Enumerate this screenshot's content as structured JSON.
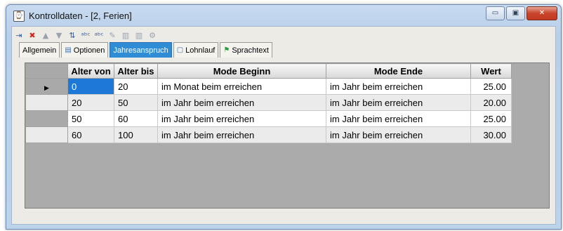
{
  "window": {
    "title": "Kontrolldaten - [2, Ferien]",
    "icon": "app-window-icon",
    "controls": {
      "minimize": "▭",
      "maximize": "▣",
      "close": "✕"
    }
  },
  "toolbar": {
    "icons": [
      {
        "name": "insert-row-icon",
        "glyph": "⇥"
      },
      {
        "name": "delete-row-icon",
        "glyph": "✖"
      },
      {
        "name": "move-up-icon",
        "glyph": "▲"
      },
      {
        "name": "move-down-icon",
        "glyph": "▼"
      },
      {
        "name": "sort-az-icon",
        "glyph": "⇅"
      },
      {
        "name": "spellcheck-icon",
        "glyph": "ᵃᵇᶜ"
      },
      {
        "name": "spellcheck-all-icon",
        "glyph": "ᵃᵇᶜ"
      },
      {
        "name": "edit-icon",
        "glyph": "✎"
      },
      {
        "name": "columns-icon",
        "glyph": "▥"
      },
      {
        "name": "columns-settings-icon",
        "glyph": "▥"
      },
      {
        "name": "properties-icon",
        "glyph": "⚙"
      }
    ]
  },
  "tabs": [
    {
      "label": "Allgemein",
      "icon": ""
    },
    {
      "label": "Optionen",
      "icon": "▤"
    },
    {
      "label": "Jahresanspruch",
      "icon": ""
    },
    {
      "label": "Lohnlauf",
      "icon": "▢"
    },
    {
      "label": "Sprachtext",
      "icon": "⚑"
    }
  ],
  "active_tab": "Jahresanspruch",
  "grid": {
    "columns": [
      "Alter von",
      "Alter bis",
      "Mode Beginn",
      "Mode Ende",
      "Wert"
    ],
    "row_indicator": "▶",
    "rows": [
      [
        "0",
        "20",
        "im Monat beim erreichen",
        "im Jahr beim erreichen",
        "25.00"
      ],
      [
        "20",
        "50",
        "im Jahr beim erreichen",
        "im Jahr beim erreichen",
        "20.00"
      ],
      [
        "50",
        "60",
        "im Jahr beim erreichen",
        "im Jahr beim erreichen",
        "25.00"
      ],
      [
        "60",
        "100",
        "im Jahr beim erreichen",
        "im Jahr beim erreichen",
        "30.00"
      ]
    ]
  }
}
